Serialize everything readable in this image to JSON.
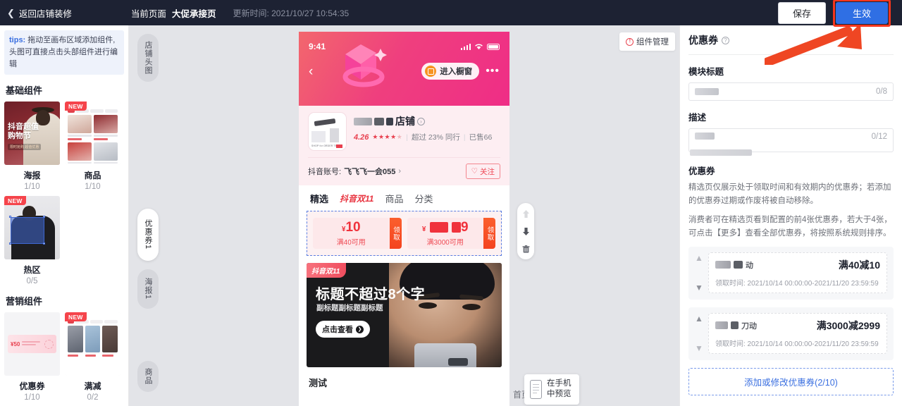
{
  "topbar": {
    "back_label": "返回店铺装修",
    "current_page_label": "当前页面",
    "current_page_value": "大促承接页",
    "update_time": "更新时间: 2021/10/27 10:54:35",
    "save_label": "保存",
    "effect_label": "生效"
  },
  "left_panel": {
    "tips_prefix": "tips:",
    "tips_text": "拖动至画布区域添加组件, 头图可直接点击头部组件进行编辑",
    "sections": [
      {
        "title": "基础组件",
        "items": [
          {
            "label": "海报",
            "count": "1/10",
            "badge": ""
          },
          {
            "label": "商品",
            "count": "1/10",
            "badge": "NEW"
          },
          {
            "label": "热区",
            "count": "0/5",
            "badge": "NEW"
          }
        ]
      },
      {
        "title": "营销组件",
        "items": [
          {
            "label": "优惠券",
            "count": "1/10",
            "badge": ""
          },
          {
            "label": "满减",
            "count": "0/2",
            "badge": "NEW"
          }
        ]
      }
    ]
  },
  "canvas": {
    "component_manage": "组件管理",
    "rail": [
      {
        "label": "店铺头图",
        "active": false
      },
      {
        "label": "优惠券1",
        "active": true
      },
      {
        "label": "海报1",
        "active": false
      },
      {
        "label": "商品",
        "active": false
      }
    ],
    "foot_hint": "首页",
    "preview_line1": "在手机",
    "preview_line2": "中预览",
    "test_text": "测试",
    "phone": {
      "status_time": "9:41",
      "window_btn": "进入橱窗",
      "shop_name": "店铺",
      "score": "4.26",
      "stars": "★★★★",
      "star_empty": "★",
      "exceed": "超过 23% 同行",
      "sold": "已售66",
      "account_label": "抖音账号:",
      "account_value": "飞飞飞一会055",
      "account_arrow": "›",
      "follow": "关注",
      "tabs": [
        "精选",
        "抖音双11",
        "商品",
        "分类"
      ],
      "coupons": [
        {
          "currency": "¥",
          "amount": "10",
          "condition": "满40可用",
          "get": "领取",
          "masked": false
        },
        {
          "currency": "¥",
          "amount": "9",
          "condition": "满3000可用",
          "get": "领取",
          "masked": true
        }
      ],
      "banner": {
        "badge": "抖音双11",
        "title": "标题不超过8个字",
        "subtitle": "副标题副标题副标题",
        "button": "点击查看"
      }
    }
  },
  "right_panel": {
    "title": "优惠券",
    "module_title_label": "模块标题",
    "module_title_count": "0/8",
    "desc_label": "描述",
    "desc_count": "0/12",
    "coupon_section_title": "优惠券",
    "desc_paragraph_1": "精选页仅展示处于领取时间和有效期内的优惠券；若添加的优惠券过期或作废将被自动移除。",
    "desc_paragraph_2": "消费者可在精选页看到配置的前4张优惠券，若大于4张，可点击【更多】查看全部优惠券，将按照系统规则排序。",
    "coupons": [
      {
        "shop": "动",
        "amount": "满40减10",
        "time": "领取时间: 2021/10/14 00:00:00-2021/11/20 23:59:59"
      },
      {
        "shop": "刀动",
        "amount": "满3000减2999",
        "time": "领取时间: 2021/10/14 00:00:00-2021/11/20 23:59:59"
      }
    ],
    "add_button": "添加或修改优惠券(2/10)"
  },
  "colors": {
    "topbar_bg": "#1d2233",
    "primary_blue": "#2f6fe4",
    "accent_red": "#f5361d",
    "coupon_red": "#f0323c"
  }
}
